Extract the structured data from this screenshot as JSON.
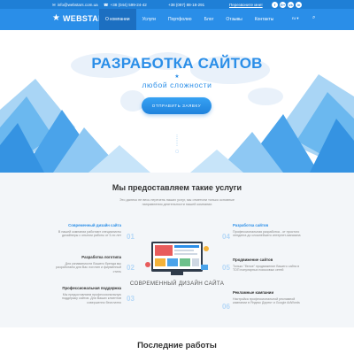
{
  "topbar": {
    "email": "info@webstars.com.ua",
    "phone1": "+38 (044) 599-24-42",
    "phone2": "+38 (097) 88-18-291",
    "callback": "Перезвоните мне!",
    "socials": [
      "f",
      "G+",
      "vk",
      "in"
    ]
  },
  "navbar": {
    "logo": "WEBSTARS",
    "items": [
      {
        "label": "О компании",
        "active": true
      },
      {
        "label": "Услуги"
      },
      {
        "label": "Портфолио"
      },
      {
        "label": "Блог"
      },
      {
        "label": "Отзывы"
      },
      {
        "label": "Контакты"
      }
    ],
    "lang": "ru"
  },
  "hero": {
    "title": "РАЗРАБОТКА САЙТОВ",
    "subtitle": "любой сложности",
    "button": "ОТПРАВИТЬ ЗАЯВКУ"
  },
  "services": {
    "title": "Мы предоставляем такие услуги",
    "lead": "Это далеко не весь перечень наших услуг, мы отметили только основные направления деятельности нашей компании",
    "left": [
      {
        "num": "01",
        "title": "Современный дизайн сайта",
        "text": "В нашей компании работают специалисты дизайнеры с опытом работы от 5-ти лет"
      },
      {
        "num": "02",
        "title": "Разработка логотипа",
        "text": "Для узнаваемости Вашего бренда мы разработаем для Вас логотип и фирменный стиль"
      },
      {
        "num": "03",
        "title": "Профессиональная поддержка",
        "text": "Мы предоставляем профессиональную поддержку сайтов. Для Ваших клиентов совершенно бесплатно"
      }
    ],
    "right": [
      {
        "num": "04",
        "title": "Разработка сайтов",
        "text": "Профессиональная разработка - от простого лендинга до сложнейшего интернет-магазина"
      },
      {
        "num": "05",
        "title": "Продвижение сайтов",
        "text": "Только \"белое\" продвижение Вашего сайта в ТОП популярных поисковых сетей"
      },
      {
        "num": "06",
        "title": "Рекламные кампании",
        "text": "Настройка профессиональной рекламной кампании в Яндекс Директ и Google AdWords"
      }
    ],
    "center_caption": "СОВРЕМЕННЫЙ ДИЗАЙН САЙТА"
  },
  "works": {
    "title": "Последние работы"
  }
}
